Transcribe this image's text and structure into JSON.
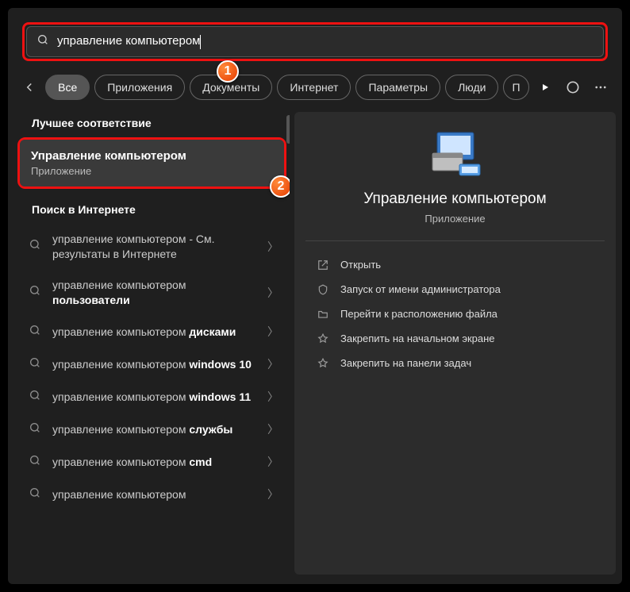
{
  "search": {
    "value": "управление компьютером"
  },
  "tabs": {
    "items": [
      {
        "label": "Все",
        "active": true
      },
      {
        "label": "Приложения"
      },
      {
        "label": "Документы"
      },
      {
        "label": "Интернет"
      },
      {
        "label": "Параметры"
      },
      {
        "label": "Люди"
      },
      {
        "label": "П"
      }
    ]
  },
  "badges": {
    "one": "1",
    "two": "2"
  },
  "left": {
    "best_heading": "Лучшее соответствие",
    "best": {
      "title": "Управление компьютером",
      "subtitle": "Приложение"
    },
    "web_heading": "Поиск в Интернете",
    "results": [
      {
        "pre": "управление компьютером",
        "bold": "",
        "suf": " - См. результаты в Интернете"
      },
      {
        "pre": "управление компьютером ",
        "bold": "пользователи",
        "suf": ""
      },
      {
        "pre": "управление компьютером ",
        "bold": "дисками",
        "suf": ""
      },
      {
        "pre": "управление компьютером ",
        "bold": "windows 10",
        "suf": ""
      },
      {
        "pre": "управление компьютером ",
        "bold": "windows 11",
        "suf": ""
      },
      {
        "pre": "управление компьютером ",
        "bold": "службы",
        "suf": ""
      },
      {
        "pre": "управление компьютером ",
        "bold": "cmd",
        "suf": ""
      },
      {
        "pre": "управление компьютером",
        "bold": "",
        "suf": ""
      }
    ]
  },
  "right": {
    "title": "Управление компьютером",
    "subtitle": "Приложение",
    "actions": [
      {
        "icon": "open",
        "label": "Открыть"
      },
      {
        "icon": "shield",
        "label": "Запуск от имени администратора"
      },
      {
        "icon": "folder",
        "label": "Перейти к расположению файла"
      },
      {
        "icon": "pin",
        "label": "Закрепить на начальном экране"
      },
      {
        "icon": "pin",
        "label": "Закрепить на панели задач"
      }
    ]
  }
}
